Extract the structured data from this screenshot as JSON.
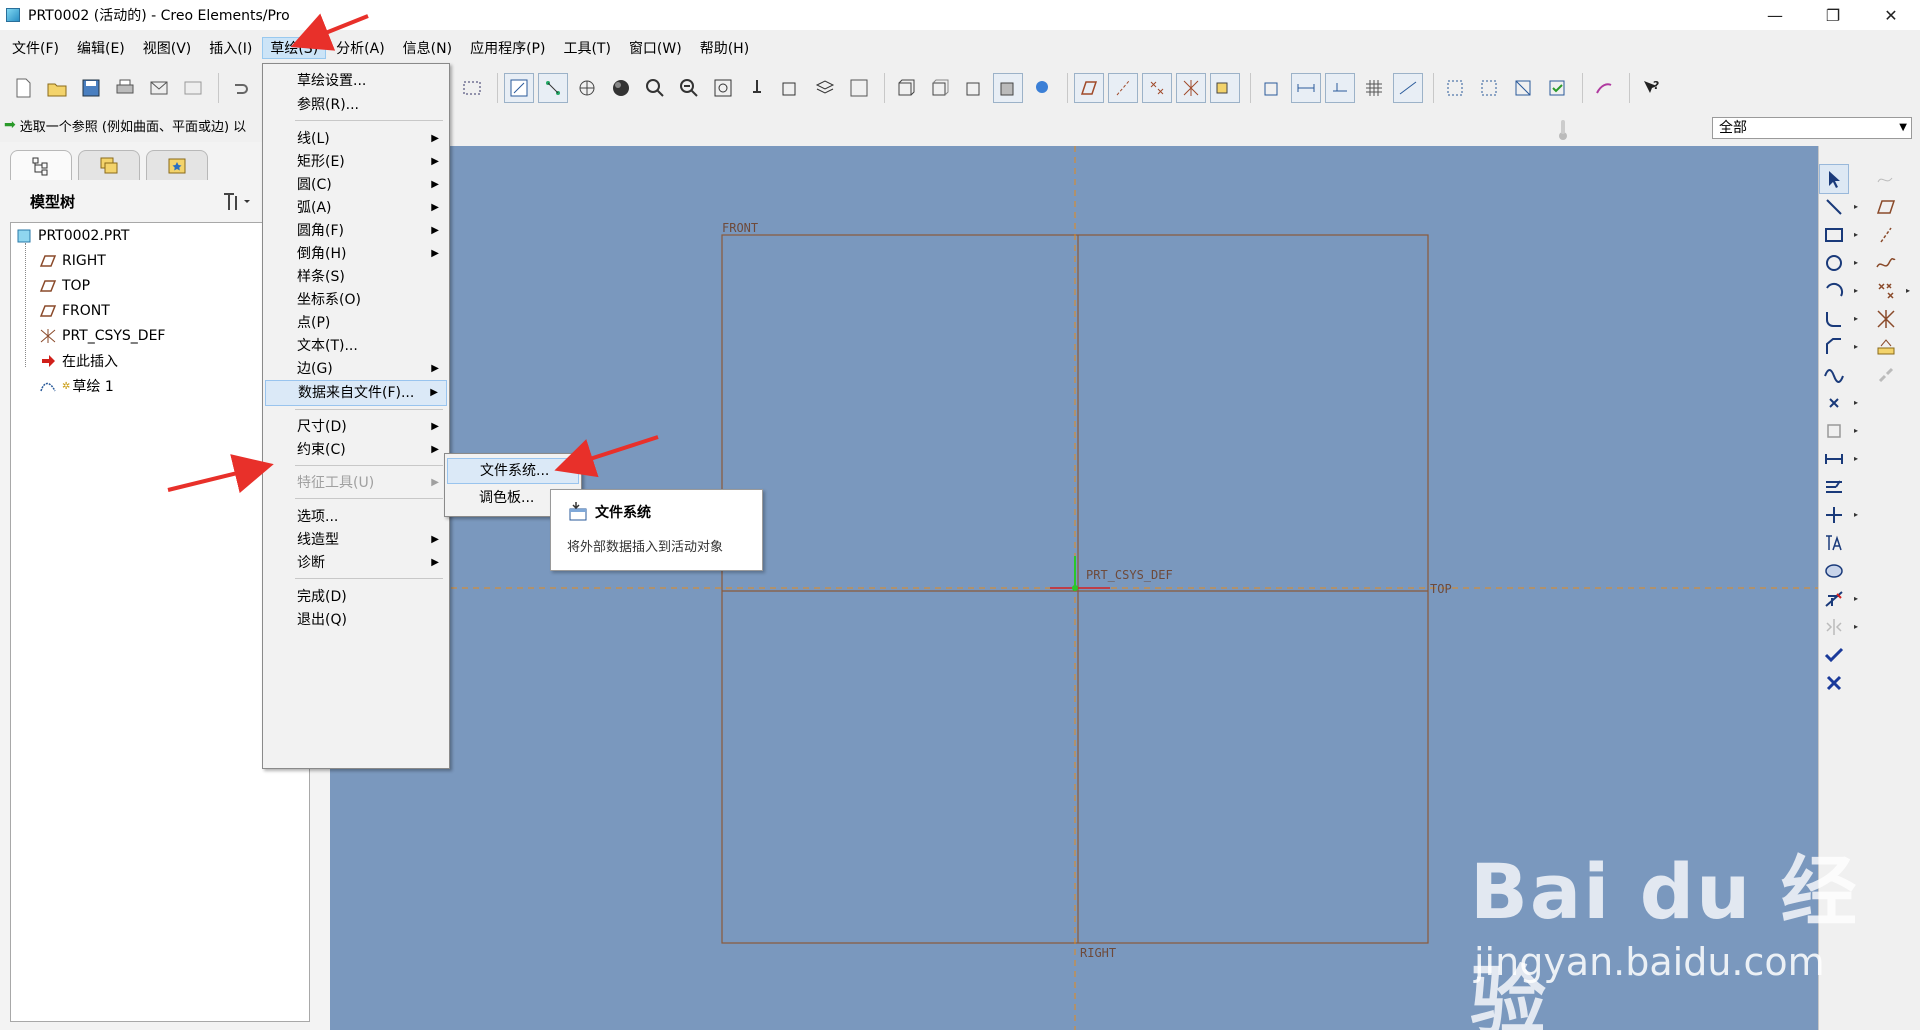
{
  "window": {
    "title": "PRT0002 (活动的) - Creo Elements/Pro",
    "minimize": "—",
    "restore": "❐",
    "close": "✕"
  },
  "menubar": {
    "items": [
      {
        "label": "文件(F)"
      },
      {
        "label": "编辑(E)"
      },
      {
        "label": "视图(V)"
      },
      {
        "label": "插入(I)"
      },
      {
        "label": "草绘(S)",
        "active": true
      },
      {
        "label": "分析(A)"
      },
      {
        "label": "信息(N)"
      },
      {
        "label": "应用程序(P)"
      },
      {
        "label": "工具(T)"
      },
      {
        "label": "窗口(W)"
      },
      {
        "label": "帮助(H)"
      }
    ]
  },
  "message": {
    "text": "选取一个参照 (例如曲面、平面或边) 以"
  },
  "filter": {
    "value": "全部"
  },
  "model_tree": {
    "title": "模型树",
    "items": [
      {
        "label": "PRT0002.PRT",
        "icon": "part-icon"
      },
      {
        "label": "RIGHT",
        "icon": "datum-plane-icon"
      },
      {
        "label": "TOP",
        "icon": "datum-plane-icon"
      },
      {
        "label": "FRONT",
        "icon": "datum-plane-icon"
      },
      {
        "label": "PRT_CSYS_DEF",
        "icon": "csys-icon"
      },
      {
        "label": "在此插入",
        "icon": "insert-here-icon"
      },
      {
        "label": "草绘 1",
        "icon": "sketch-icon"
      }
    ]
  },
  "sketch_menu": {
    "items": [
      {
        "label": "草绘设置..."
      },
      {
        "label": "参照(R)..."
      },
      {
        "label": "线(L)",
        "sub": true
      },
      {
        "label": "矩形(E)",
        "sub": true
      },
      {
        "label": "圆(C)",
        "sub": true
      },
      {
        "label": "弧(A)",
        "sub": true
      },
      {
        "label": "圆角(F)",
        "sub": true
      },
      {
        "label": "倒角(H)",
        "sub": true
      },
      {
        "label": "样条(S)"
      },
      {
        "label": "坐标系(O)"
      },
      {
        "label": "点(P)"
      },
      {
        "label": "文本(T)..."
      },
      {
        "label": "边(G)",
        "sub": true
      },
      {
        "label": "数据来自文件(F)...",
        "sub": true,
        "highlight": true
      },
      {
        "label": "尺寸(D)",
        "sub": true
      },
      {
        "label": "约束(C)",
        "sub": true
      },
      {
        "label": "特征工具(U)",
        "sub": true,
        "disabled": true
      },
      {
        "label": "选项..."
      },
      {
        "label": "线造型",
        "sub": true
      },
      {
        "label": "诊断",
        "sub": true
      },
      {
        "label": "完成(D)"
      },
      {
        "label": "退出(Q)"
      }
    ]
  },
  "submenu": {
    "items": [
      {
        "label": "文件系统...",
        "highlight": true
      },
      {
        "label": "调色板..."
      }
    ]
  },
  "tooltip": {
    "title": "文件系统",
    "description": "将外部数据插入到活动对象"
  },
  "datums": {
    "front": "FRONT",
    "top": "TOP",
    "right": "RIGHT",
    "csys": "PRT_CSYS_DEF"
  },
  "watermark": {
    "brand": "Bai du 经验",
    "url": "jingyan.baidu.com"
  },
  "colors": {
    "graphics_bg": "#7a98be",
    "datum_line": "#8a5a3a",
    "annotation_arrow": "#e8302a",
    "menu_highlight": "#dbe9f7"
  }
}
